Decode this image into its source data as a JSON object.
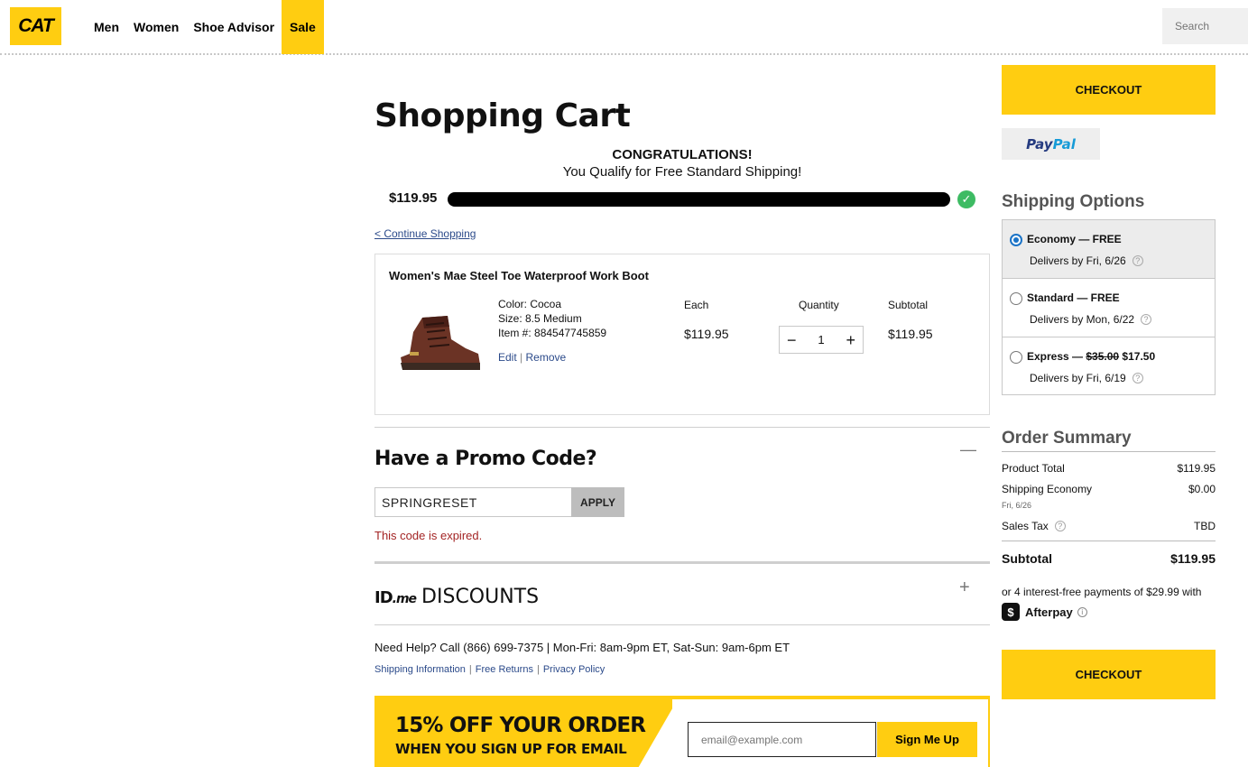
{
  "header": {
    "logo": "CAT",
    "nav": [
      {
        "label": "Men"
      },
      {
        "label": "Women"
      },
      {
        "label": "Shoe Advisor"
      },
      {
        "label": "Sale"
      }
    ],
    "search_placeholder": "Search"
  },
  "cart": {
    "title": "Shopping Cart",
    "congrats_title": "CONGRATULATIONS!",
    "congrats_sub": "You Qualify for Free Standard Shipping!",
    "progress_amount": "$119.95",
    "progress_fraction": 1.0,
    "continue_link": "< Continue Shopping",
    "item": {
      "name": "Women's Mae Steel Toe Waterproof Work Boot",
      "color": "Color: Cocoa",
      "size": "Size: 8.5 Medium",
      "item_no": "Item #: 884547745859",
      "edit": "Edit",
      "remove": "Remove",
      "each_label": "Each",
      "each_value": "$119.95",
      "qty_label": "Quantity",
      "qty_value": "1",
      "subtotal_label": "Subtotal",
      "subtotal_value": "$119.95"
    }
  },
  "promo": {
    "title": "Have a Promo Code?",
    "toggle": "—",
    "code": "SPRINGRESET",
    "apply": "APPLY",
    "error": "This code is expired."
  },
  "idme": {
    "logo_id": "ID",
    "logo_me": ".me",
    "text": "DISCOUNTS",
    "toggle": "+"
  },
  "help": {
    "text": "Need Help? Call (866) 699-7375 | Mon-Fri: 8am-9pm ET, Sat-Sun: 9am-6pm ET",
    "links": [
      "Shipping Information",
      "Free Returns",
      "Privacy Policy"
    ]
  },
  "email_banner": {
    "line1": "15% OFF YOUR ORDER",
    "line2": "WHEN YOU SIGN UP FOR EMAIL",
    "placeholder": "email@example.com",
    "button": "Sign Me Up"
  },
  "sidebar": {
    "checkout": "CHECKOUT",
    "paypal_pay": "Pay",
    "paypal_pal": "Pal",
    "shipping_title": "Shipping Options",
    "shipping_options": [
      {
        "label": "Economy — FREE",
        "delivery": "Delivers by Fri, 6/26",
        "selected": true
      },
      {
        "label": "Standard — FREE",
        "delivery": "Delivers by Mon, 6/22",
        "selected": false
      },
      {
        "label_prefix": "Express — ",
        "old_price": "$35.00",
        "new_price": "$17.50",
        "delivery": "Delivers by Fri, 6/19",
        "selected": false
      }
    ],
    "summary_title": "Order Summary",
    "summary": {
      "product_total_label": "Product Total",
      "product_total": "$119.95",
      "shipping_label": "Shipping Economy",
      "shipping_value": "$0.00",
      "shipping_date": "Fri, 6/26",
      "tax_label": "Sales Tax",
      "tax_value": "TBD",
      "subtotal_label": "Subtotal",
      "subtotal_value": "$119.95"
    },
    "afterpay_text": "or 4 interest-free payments of $29.99 with",
    "afterpay_brand": "Afterpay"
  },
  "colors": {
    "brand_yellow": "#ffcd11",
    "link_blue": "#2b4a8a",
    "success_green": "#3dbb63",
    "error_red": "#a32424"
  }
}
